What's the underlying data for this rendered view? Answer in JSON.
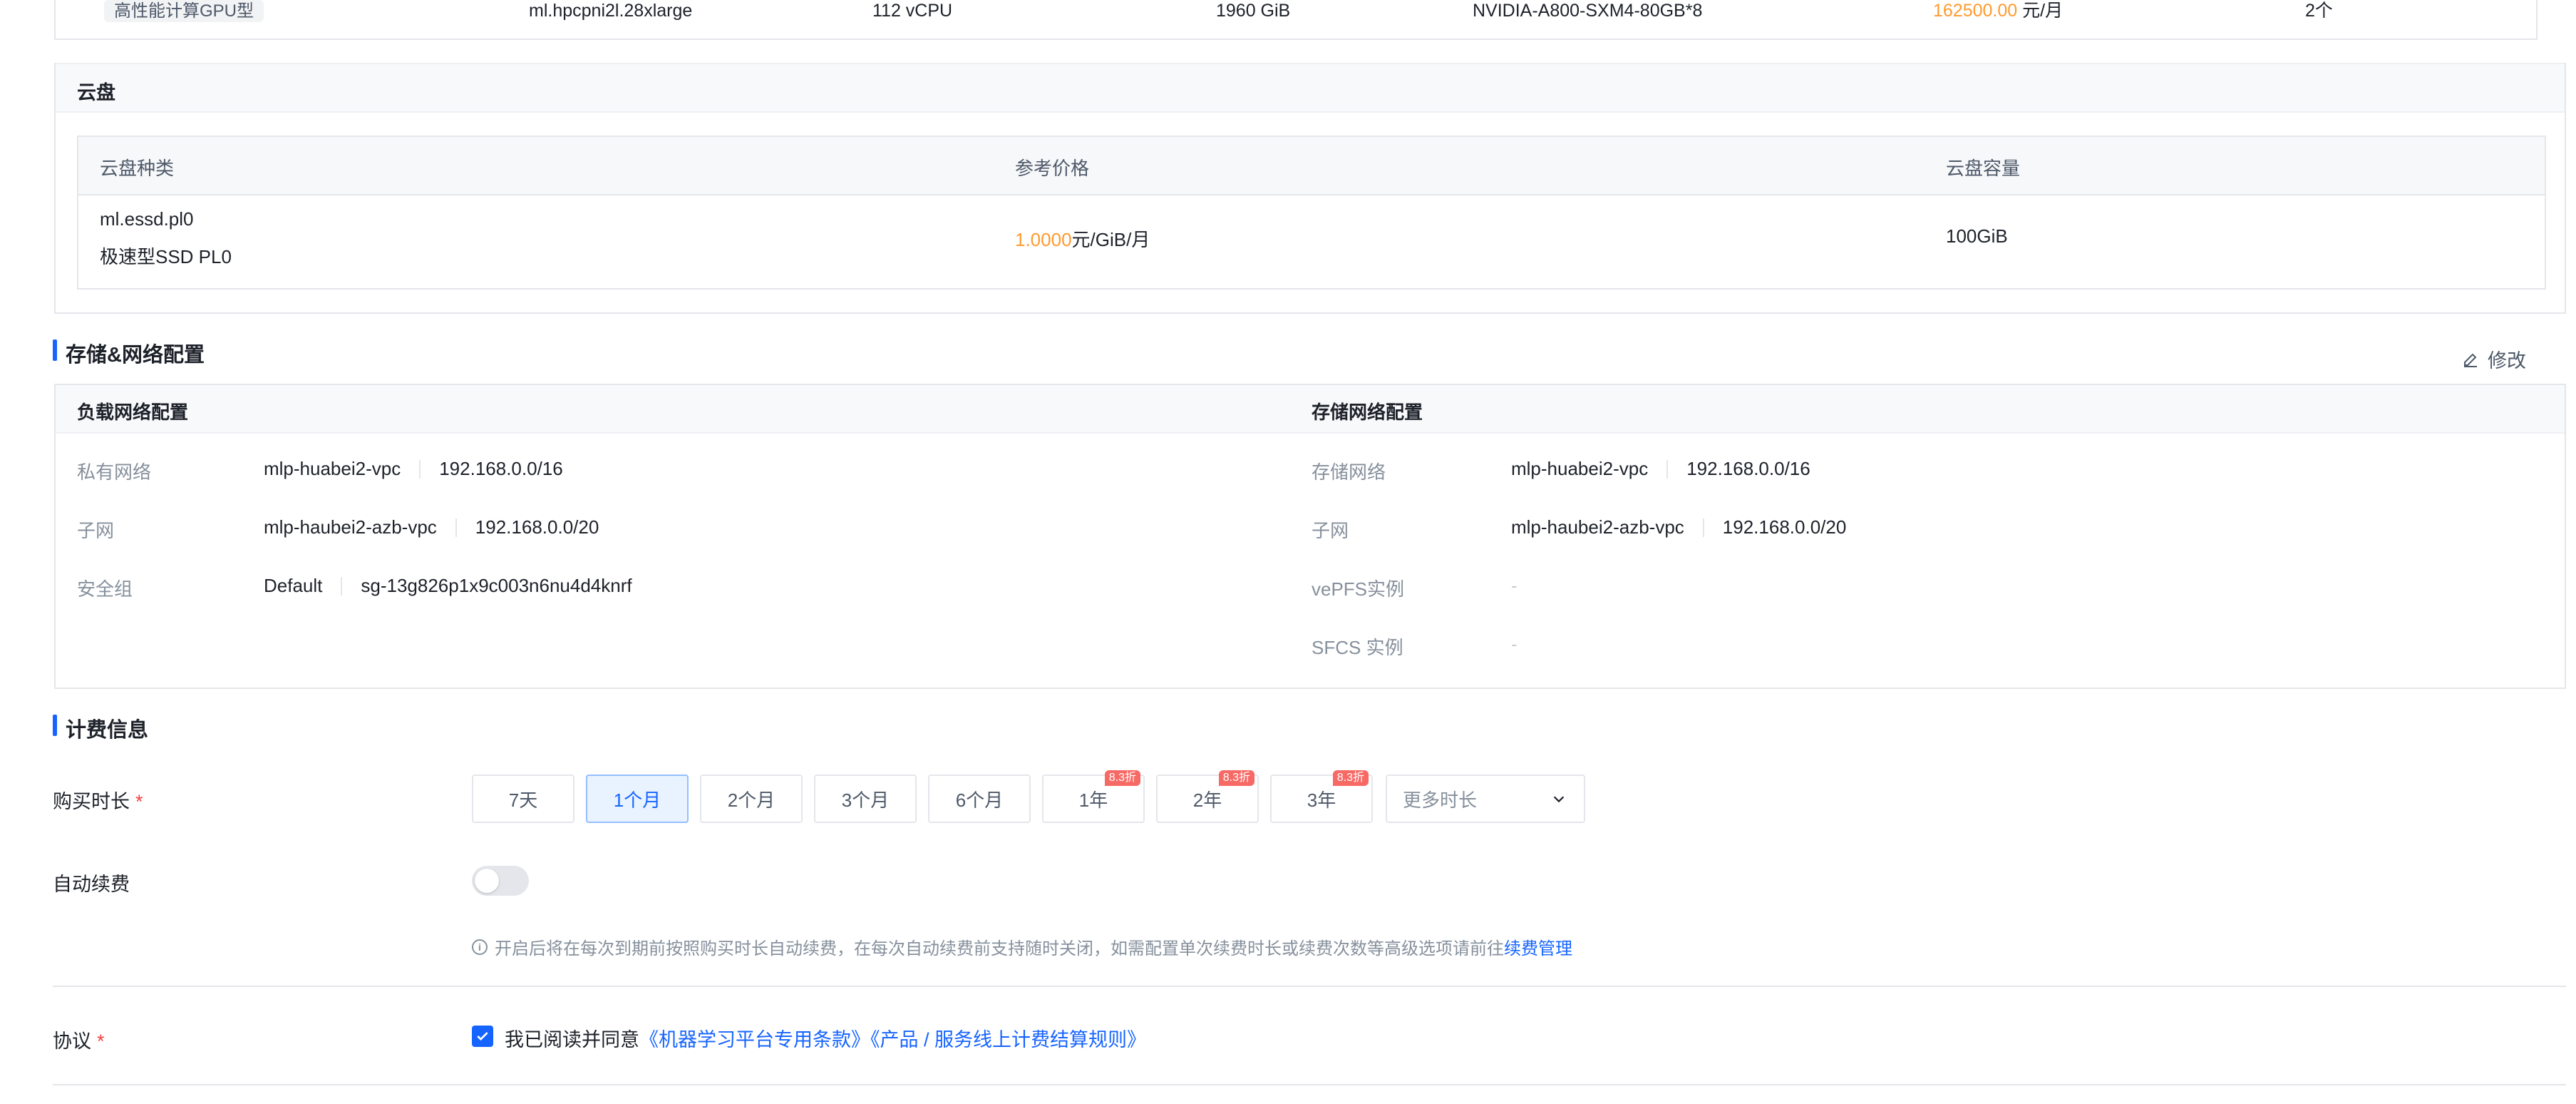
{
  "spec_row": {
    "type_tag": "高性能计算GPU型",
    "instance_spec": "ml.hpcpni2l.28xlarge",
    "vcpu": "112 vCPU",
    "memory": "1960 GiB",
    "gpu": "NVIDIA-A800-SXM4-80GB*8",
    "price_value": "162500.00",
    "price_unit": "元/月",
    "count": "2个"
  },
  "cloud_disk": {
    "title": "云盘",
    "headers": [
      "云盘种类",
      "参考价格",
      "云盘容量"
    ],
    "row": {
      "type_code": "ml.essd.pl0",
      "type_name": "极速型SSD PL0",
      "price_value": "1.0000",
      "price_unit": "元/GiB/月",
      "capacity": "100GiB"
    }
  },
  "storage_network": {
    "title": "存储&网络配置",
    "edit_label": "修改",
    "load_network": {
      "title": "负载网络配置",
      "rows": [
        {
          "label": "私有网络",
          "name": "mlp-huabei2-vpc",
          "cidr": "192.168.0.0/16"
        },
        {
          "label": "子网",
          "name": "mlp-haubei2-azb-vpc",
          "cidr": "192.168.0.0/20"
        },
        {
          "label": "安全组",
          "name": "Default",
          "cidr": "sg-13g826p1x9c003n6nu4d4knrf"
        }
      ]
    },
    "storage_net": {
      "title": "存储网络配置",
      "rows": [
        {
          "label": "存储网络",
          "name": "mlp-huabei2-vpc",
          "cidr": "192.168.0.0/16"
        },
        {
          "label": "子网",
          "name": "mlp-haubei2-azb-vpc",
          "cidr": "192.168.0.0/20"
        },
        {
          "label": "vePFS实例",
          "value": "-"
        },
        {
          "label": "SFCS 实例",
          "value": "-"
        }
      ]
    }
  },
  "billing": {
    "title": "计费信息",
    "duration_label": "购买时长",
    "required_mark": "*",
    "durations": [
      {
        "label": "7天",
        "badge": ""
      },
      {
        "label": "1个月",
        "badge": ""
      },
      {
        "label": "2个月",
        "badge": ""
      },
      {
        "label": "3个月",
        "badge": ""
      },
      {
        "label": "6个月",
        "badge": ""
      },
      {
        "label": "1年",
        "badge": "8.3折"
      },
      {
        "label": "2年",
        "badge": "8.3折"
      },
      {
        "label": "3年",
        "badge": "8.3折"
      }
    ],
    "selected_duration": "1个月",
    "more_label": "更多时长",
    "auto_renew_label": "自动续费",
    "auto_renew_on": false,
    "hint_text": "开启后将在每次到期前按照购买时长自动续费，在每次自动续费前支持随时关闭，如需配置单次续费时长或续费次数等高级选项请前往",
    "hint_link": "续费管理",
    "agreement_label": "协议",
    "agreement_prefix": "我已阅读并同意",
    "agreement_link1": "《机器学习平台专用条款》",
    "agreement_link2": "《产品 / 服务线上计费结算规则》",
    "agreement_checked": true
  },
  "colors": {
    "accent": "#1664ff",
    "price": "#ff9a2e",
    "required": "#f53f3f",
    "badge": "#f76965"
  }
}
